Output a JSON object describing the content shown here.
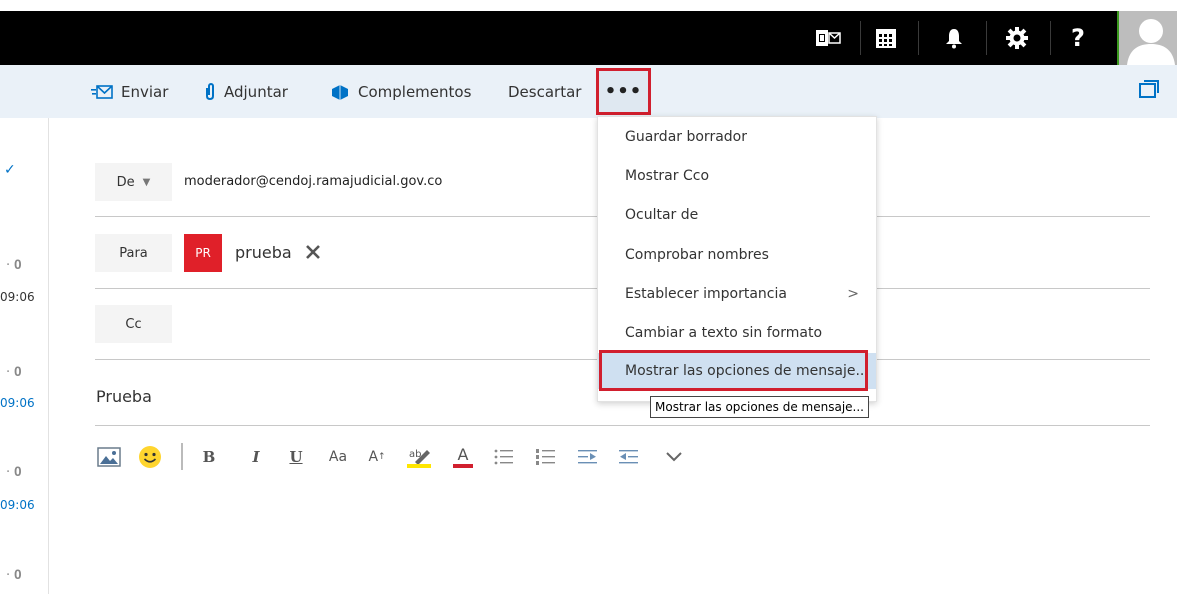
{
  "topbar": {
    "icons": [
      "outlook-icon",
      "calendar-icon",
      "bell-icon",
      "gear-icon",
      "help-icon"
    ],
    "help_label": "?"
  },
  "commands": {
    "send": "Enviar",
    "attach": "Adjuntar",
    "addins": "Complementos",
    "discard": "Descartar",
    "more": "•••"
  },
  "left_pane": {
    "times": [
      "09:06",
      "09:06",
      "09:06"
    ]
  },
  "compose": {
    "from_label": "De",
    "from_value": "moderador@cendoj.ramajudicial.gov.co",
    "to_label": "Para",
    "recipient_initials": "PR",
    "recipient_name": "prueba",
    "cc_label": "Cc",
    "subject": "Prueba"
  },
  "more_menu": {
    "items": [
      "Guardar borrador",
      "Mostrar Cco",
      "Ocultar de",
      "Comprobar nombres",
      "Establecer importancia",
      "Cambiar a texto sin formato",
      "Mostrar las opciones de mensaje..."
    ],
    "submenu_arrow": ">",
    "tooltip": "Mostrar las opciones de mensaje..."
  },
  "format_toolbar": {
    "bold": "B",
    "italic": "I",
    "underline": "U",
    "font_size": "Aa",
    "grow": "A",
    "font_color": "A"
  },
  "colors": {
    "accent": "#0072c6",
    "highlight_frame": "#d11f2e",
    "recipient_chip": "#e02029",
    "command_bar": "#eaf1f8"
  }
}
